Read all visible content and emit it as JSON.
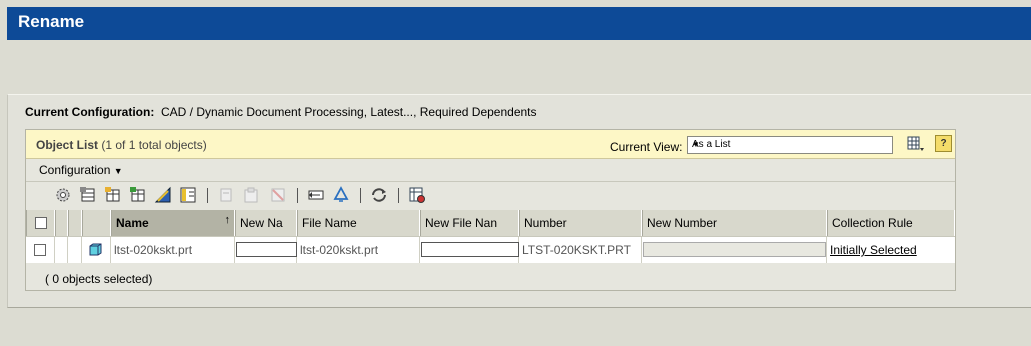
{
  "window": {
    "title": "Rename"
  },
  "config": {
    "label": "Current Configuration:",
    "value": "CAD / Dynamic Document Processing, Latest..., Required Dependents"
  },
  "object_list": {
    "title": "Object List",
    "count": "(1 of 1 total objects)",
    "current_view_label": "Current View:",
    "current_view_value": "As a List",
    "help_label": "?",
    "menu_label": "Configuration",
    "footer": "( 0 objects selected)"
  },
  "toolbar": {
    "icons": [
      "gear-icon",
      "insert-row-icon",
      "add-table-icon",
      "add-table-green-icon",
      "pencil-ruler-icon",
      "columns-icon",
      "copy-disabled-icon",
      "paste-disabled-icon",
      "delete-disabled-icon",
      "rename-icon",
      "recycle-icon",
      "refresh-icon",
      "table-settings-icon"
    ]
  },
  "table": {
    "columns": [
      "Name",
      "New Na",
      "File Name",
      "New File Nan",
      "Number",
      "New Number",
      "Collection Rule"
    ],
    "sort_indicator": "↑",
    "rows": [
      {
        "name": "ltst-020kskt.prt",
        "new_name": "",
        "file_name": "ltst-020kskt.prt",
        "new_file_name": "",
        "number": "LTST-020KSKT.PRT",
        "new_number": "",
        "collection_rule": "Initially Selected"
      }
    ]
  },
  "colors": {
    "titlebar": "#0d4a97",
    "list_header": "#fdf7c6",
    "background": "#dcdcd2"
  }
}
